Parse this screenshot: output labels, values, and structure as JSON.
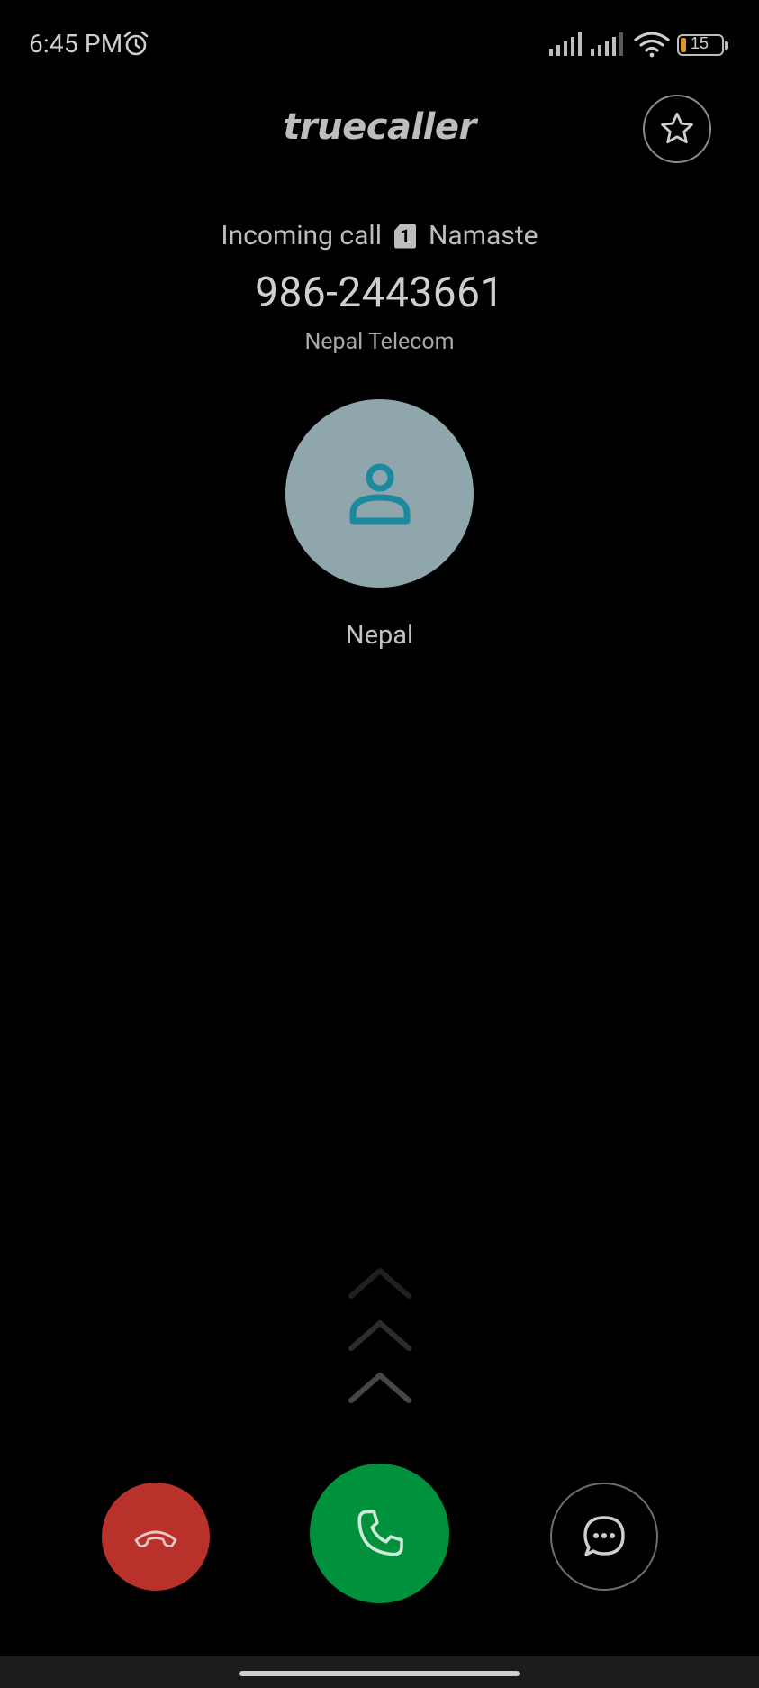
{
  "status_bar": {
    "time": "6:45 PM",
    "battery_level": "15",
    "icons": [
      "alarm-icon",
      "signal-icon",
      "signal-icon",
      "wifi-icon",
      "battery-icon"
    ]
  },
  "header": {
    "brand": "truecaller",
    "star_icon": "star-outline-icon"
  },
  "call": {
    "status": "Incoming call",
    "sim_slot": "1",
    "sim_name": "Namaste",
    "number": "986-2443661",
    "carrier": "Nepal Telecom",
    "location": "Nepal",
    "avatar_icon": "person-icon"
  },
  "actions": {
    "decline_icon": "hang-up-icon",
    "answer_icon": "phone-icon",
    "message_icon": "chat-bubble-icon"
  },
  "colors": {
    "background": "#000000",
    "decline": "#b8312b",
    "answer": "#00913c",
    "avatar": "#8fa6ac",
    "avatar_icon": "#1b8a9e"
  }
}
